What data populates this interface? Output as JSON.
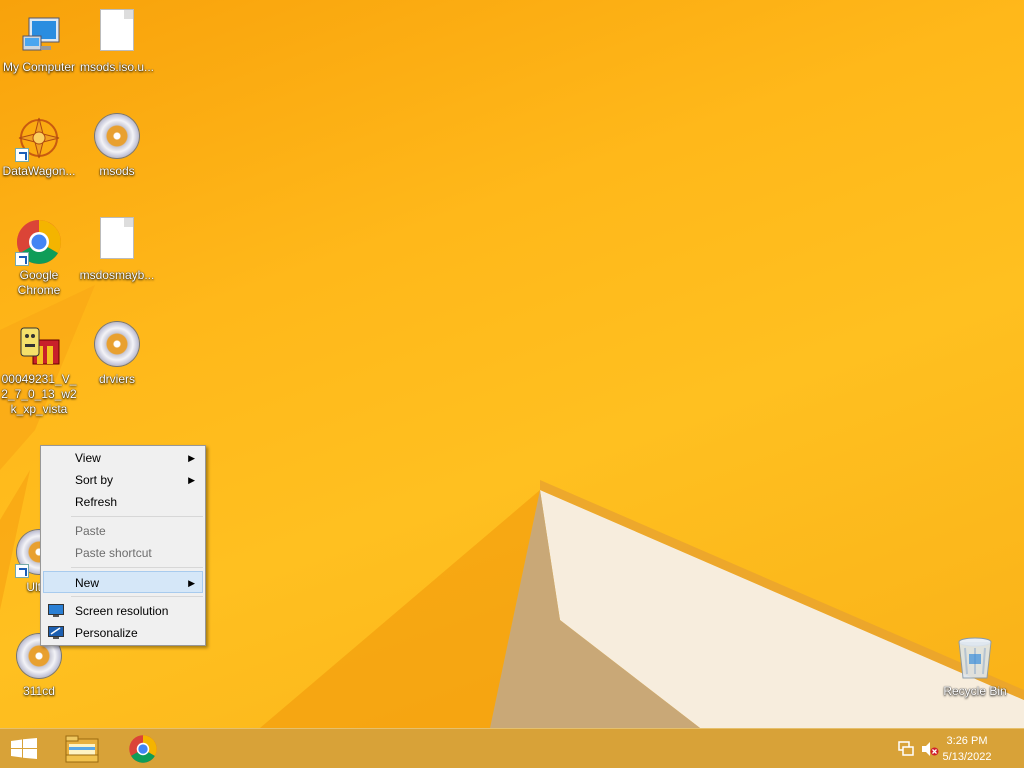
{
  "desktop_icons": [
    {
      "label": "My Computer",
      "icon": "computer-icon"
    },
    {
      "label": "msods.iso.u...",
      "icon": "file-icon"
    },
    {
      "label": "DataWagon...",
      "icon": "datawagon-icon"
    },
    {
      "label": "msods",
      "icon": "disc-icon"
    },
    {
      "label": "Google Chrome",
      "icon": "chrome-icon"
    },
    {
      "label": "msdosmayb...",
      "icon": "file-icon"
    },
    {
      "label": "00049231_V_2_7_0_13_w2k_xp_vista",
      "icon": "installer-icon"
    },
    {
      "label": "drviers",
      "icon": "disc-icon"
    },
    {
      "label": "Ultra",
      "icon": "disc-icon"
    },
    {
      "label": "311cd",
      "icon": "disc-icon"
    },
    {
      "label": "Recycle Bin",
      "icon": "recycle-bin-icon"
    }
  ],
  "context_menu": {
    "view": "View",
    "sort_by": "Sort by",
    "refresh": "Refresh",
    "paste": "Paste",
    "paste_shortcut": "Paste shortcut",
    "new": "New",
    "screen_resolution": "Screen resolution",
    "personalize": "Personalize",
    "submenu_arrow": "▶"
  },
  "taskbar": {
    "pinned": [
      "start-icon",
      "file-explorer-icon",
      "chrome-icon"
    ],
    "tray": [
      "network-icon",
      "volume-muted-icon"
    ],
    "time": "3:26 PM",
    "date": "5/13/2022"
  },
  "colors": {
    "desktop_bg": "#ffb81a",
    "taskbar_bg": "#d8a238",
    "menu_highlight": "#d5e7f8"
  }
}
